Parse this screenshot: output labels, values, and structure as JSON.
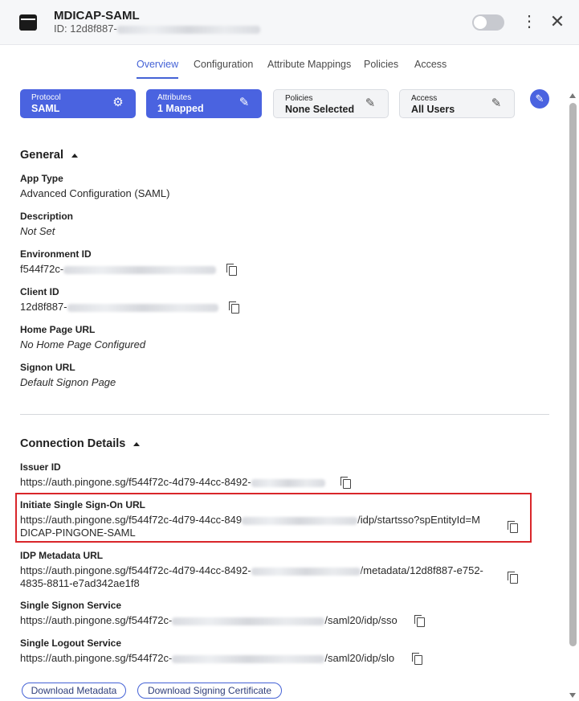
{
  "header": {
    "title": "MDICAP-SAML",
    "id_prefix": "ID: 12d8f887-",
    "icons": {
      "app": "app-window-icon",
      "more": "kebab-icon",
      "close": "close-icon"
    }
  },
  "tabs": [
    "Overview",
    "Configuration",
    "Attribute Mappings",
    "Policies",
    "Access"
  ],
  "cards": {
    "protocol": {
      "label": "Protocol",
      "value": "SAML",
      "icon": "gears-icon"
    },
    "attributes": {
      "label": "Attributes",
      "value": "1 Mapped",
      "icon": "pencil-icon"
    },
    "policies": {
      "label": "Policies",
      "value": "None Selected",
      "icon": "pencil-icon"
    },
    "access": {
      "label": "Access",
      "value": "All Users",
      "icon": "pencil-icon"
    }
  },
  "general": {
    "title": "General",
    "app_type_label": "App Type",
    "app_type_value": "Advanced Configuration (SAML)",
    "description_label": "Description",
    "description_value": "Not Set",
    "environment_id_label": "Environment ID",
    "environment_id_prefix": "f544f72c-",
    "client_id_label": "Client ID",
    "client_id_prefix": "12d8f887-",
    "home_page_label": "Home Page URL",
    "home_page_value": "No Home Page Configured",
    "signon_label": "Signon URL",
    "signon_value": "Default Signon Page"
  },
  "connection": {
    "title": "Connection Details",
    "issuer_label": "Issuer ID",
    "issuer_prefix": "https://auth.pingone.sg/f544f72c-4d79-44cc-8492-",
    "initiate_label": "Initiate Single Sign-On URL",
    "initiate_prefix": "https://auth.pingone.sg/f544f72c-4d79-44cc-849",
    "initiate_suffix": "/idp/startsso?spEntityId=M",
    "initiate_line2": "DICAP-PINGONE-SAML",
    "metadata_label": "IDP Metadata URL",
    "metadata_prefix": "https://auth.pingone.sg/f544f72c-4d79-44cc-8492-",
    "metadata_suffix": "/metadata/12d8f887-e752-",
    "metadata_line2": "4835-8811-e7ad342ae1f8",
    "sso_label": "Single Signon Service",
    "sso_prefix": "https://auth.pingone.sg/f544f72c-",
    "sso_suffix": "/saml20/idp/sso",
    "slo_label": "Single Logout Service",
    "slo_prefix": "https://auth.pingone.sg/f544f72c-",
    "slo_suffix": "/saml20/idp/slo"
  },
  "buttons": {
    "download_metadata": "Download Metadata",
    "download_cert": "Download Signing Certificate"
  },
  "colors": {
    "accent": "#4a63e0",
    "highlight": "#d9262a"
  }
}
